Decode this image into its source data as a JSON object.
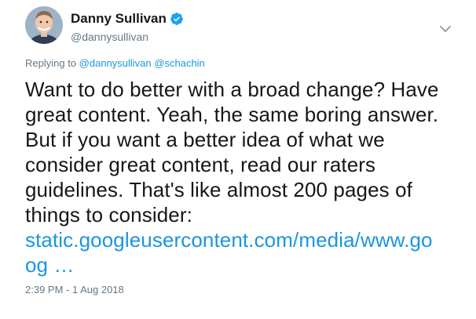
{
  "author": {
    "display_name": "Danny Sullivan",
    "handle": "@dannysullivan",
    "verified": true
  },
  "reply_context": {
    "prefix": "Replying to",
    "mentions": [
      "@dannysullivan",
      "@schachin"
    ]
  },
  "tweet": {
    "lines": [
      "Want to do better with a broad change? Have",
      "great content. Yeah, the same boring answer.",
      "But if you want a better idea of what we",
      "consider great content, read our raters",
      "guidelines. That's like almost 200 pages of",
      "things to consider:"
    ],
    "link_line1": "static.googleusercontent.com/media/www.go",
    "link_line2": "og   …"
  },
  "timestamp": "2:39 PM - 1 Aug 2018",
  "icons": {
    "verified": "verified-badge-icon",
    "caret": "chevron-down-icon"
  },
  "colors": {
    "link": "#1b95e0",
    "secondary_text": "#657786",
    "primary_text": "#14171a",
    "verified_badge": "#1da1f2"
  }
}
